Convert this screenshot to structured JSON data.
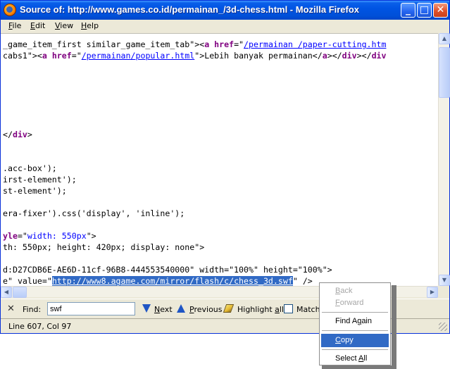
{
  "window": {
    "title": "Source of: http://www.games.co.id/permainan_/3d-chess.html - Mozilla Firefox",
    "minimize_glyph": "_",
    "maximize_glyph": "□",
    "close_glyph": "✕"
  },
  "menu": [
    {
      "id": "file",
      "label_u": "F",
      "label_rest": "ile"
    },
    {
      "id": "edit",
      "label_u": "E",
      "label_rest": "dit"
    },
    {
      "id": "view",
      "label_u": "V",
      "label_rest": "iew"
    },
    {
      "id": "help",
      "label_u": "H",
      "label_rest": "elp"
    }
  ],
  "source": {
    "l1_a": "_game_item_first similar_game_item_tab\"><",
    "l1_b": "a",
    "l1_c": " ",
    "l1_d": "href",
    "l1_e": "=\"",
    "l1_f": "/permainan /paper-cutting.htm",
    "l2_a": "cabs1\"><",
    "l2_b": "a",
    "l2_c": " ",
    "l2_d": "href",
    "l2_e": "=\"",
    "l2_f": "/permainan/popular.html",
    "l2_g": "\">Lebih banyak permainan</",
    "l2_h": "a",
    "l2_i": "></",
    "l2_j": "div",
    "l2_k": "></",
    "l2_l": "div",
    "l3_a": "</",
    "l3_b": "div",
    "l3_c": ">",
    "l4": ".acc-box');",
    "l5": "irst-element');",
    "l6": "st-element');",
    "l7": "era-fixer').css('display', 'inline');",
    "l8_a": "yle",
    "l8_b": "=\"",
    "l8_c": "width: 550px",
    "l8_d": "\">",
    "l9": "th: 550px; height: 420px; display: none\">",
    "l10": "d:D27CDB6E-AE6D-11cf-96B8-444553540000\" width=\"100%\" height=\"100%\">",
    "l11_a": "e\" value=\"",
    "l11_b": "http://www8.agame.com/mirror/flash/c/chess_3d.",
    "l11_c": "swf",
    "l11_d": "\" />"
  },
  "findbar": {
    "close_glyph": "✕",
    "find_label": "Find:",
    "find_value": "swf",
    "next_u": "N",
    "next_rest": "ext",
    "previous_u": "P",
    "previous_rest": "revious",
    "highlight_a": "Highlight ",
    "highlight_u": "a",
    "highlight_b": "ll",
    "match_label": "Match"
  },
  "status": {
    "text": "Line 607, Col 97"
  },
  "context_menu": {
    "back_u": "B",
    "back_rest": "ack",
    "forward_u": "F",
    "forward_rest": "orward",
    "find_again_a": "Find A",
    "find_again_u": "g",
    "find_again_b": "ain",
    "copy_u": "C",
    "copy_rest": "opy",
    "select_all_a": "Select ",
    "select_all_u": "A",
    "select_all_b": "ll"
  },
  "colors": {
    "titlebar": "#0054e3",
    "selection": "#316ac5",
    "keyword": "#800080",
    "string": "#0000ff"
  }
}
